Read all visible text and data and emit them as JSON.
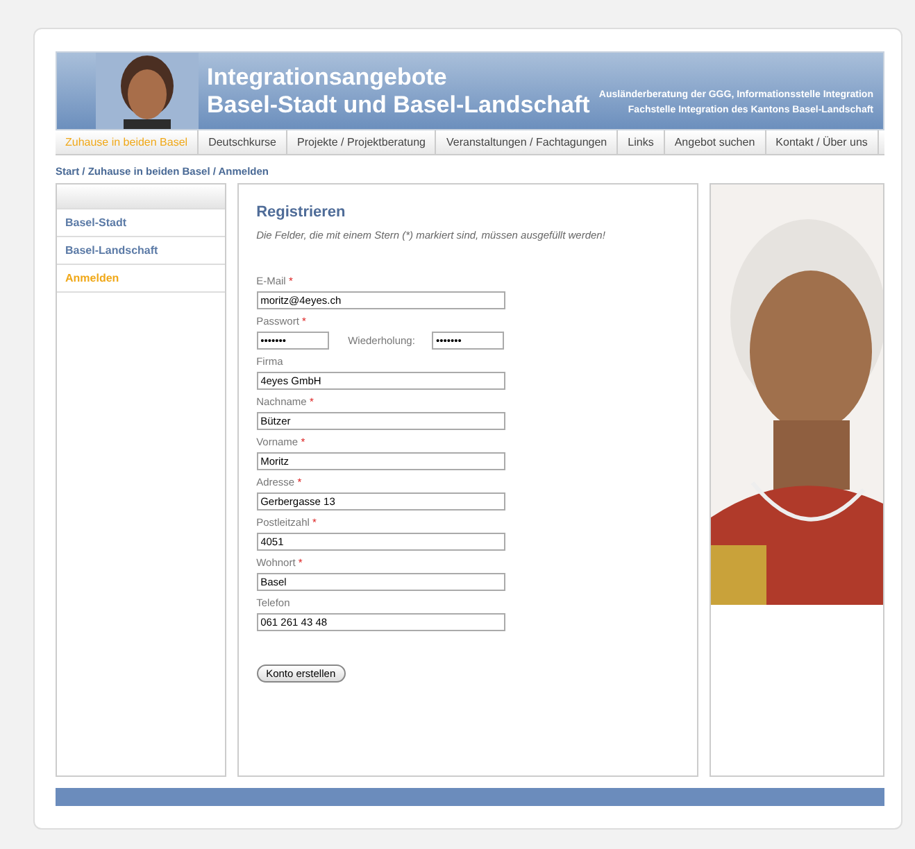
{
  "header": {
    "title_line_1": "Integrationsangebote",
    "title_line_2": "Basel-Stadt und Basel-Landschaft",
    "org_line_1": "Ausländerberatung der GGG, Informationsstelle Integration",
    "org_line_2": "Fachstelle Integration des Kantons Basel-Landschaft"
  },
  "nav": [
    {
      "label": "Zuhause in beiden Basel",
      "selected": true
    },
    {
      "label": "Deutschkurse",
      "selected": false
    },
    {
      "label": "Projekte / Projektberatung",
      "selected": false
    },
    {
      "label": "Veranstaltungen / Fachtagungen",
      "selected": false
    },
    {
      "label": "Links",
      "selected": false
    },
    {
      "label": "Angebot suchen",
      "selected": false
    },
    {
      "label": "Kontakt / Über uns",
      "selected": false
    }
  ],
  "breadcrumb": "Start / Zuhause in beiden Basel / Anmelden",
  "sidebar": {
    "items": [
      {
        "label": "Basel-Stadt",
        "selected": false
      },
      {
        "label": "Basel-Landschaft",
        "selected": false
      },
      {
        "label": "Anmelden",
        "selected": true
      }
    ]
  },
  "form": {
    "title": "Registrieren",
    "note": "Die Felder, die mit einem Stern (*) markiert sind, müssen ausgefüllt werden!",
    "fields": [
      {
        "kind": "text",
        "label": "E-Mail",
        "required_mark": "*",
        "value": "moritz@4eyes.ch"
      },
      {
        "kind": "password_pair",
        "label": "Passwort",
        "required_mark": "*",
        "value": "•••••••",
        "repeat_label": "Wiederholung:",
        "repeat_value": "•••••••"
      },
      {
        "kind": "text",
        "label": "Firma",
        "value": "4eyes GmbH"
      },
      {
        "kind": "text",
        "label": "Nachname",
        "required_mark": "*",
        "value": "Bützer"
      },
      {
        "kind": "text",
        "label": "Vorname",
        "required_mark": "*",
        "value": "Moritz"
      },
      {
        "kind": "text",
        "label": "Adresse",
        "required_mark": "*",
        "value": "Gerbergasse 13"
      },
      {
        "kind": "text",
        "label": "Postleitzahl",
        "required_mark": "*",
        "value": "4051"
      },
      {
        "kind": "text",
        "label": "Wohnort",
        "required_mark": "*",
        "value": "Basel"
      },
      {
        "kind": "text",
        "label": "Telefon",
        "value": "061 261 43 48"
      }
    ],
    "submit": "Konto erstellen"
  }
}
